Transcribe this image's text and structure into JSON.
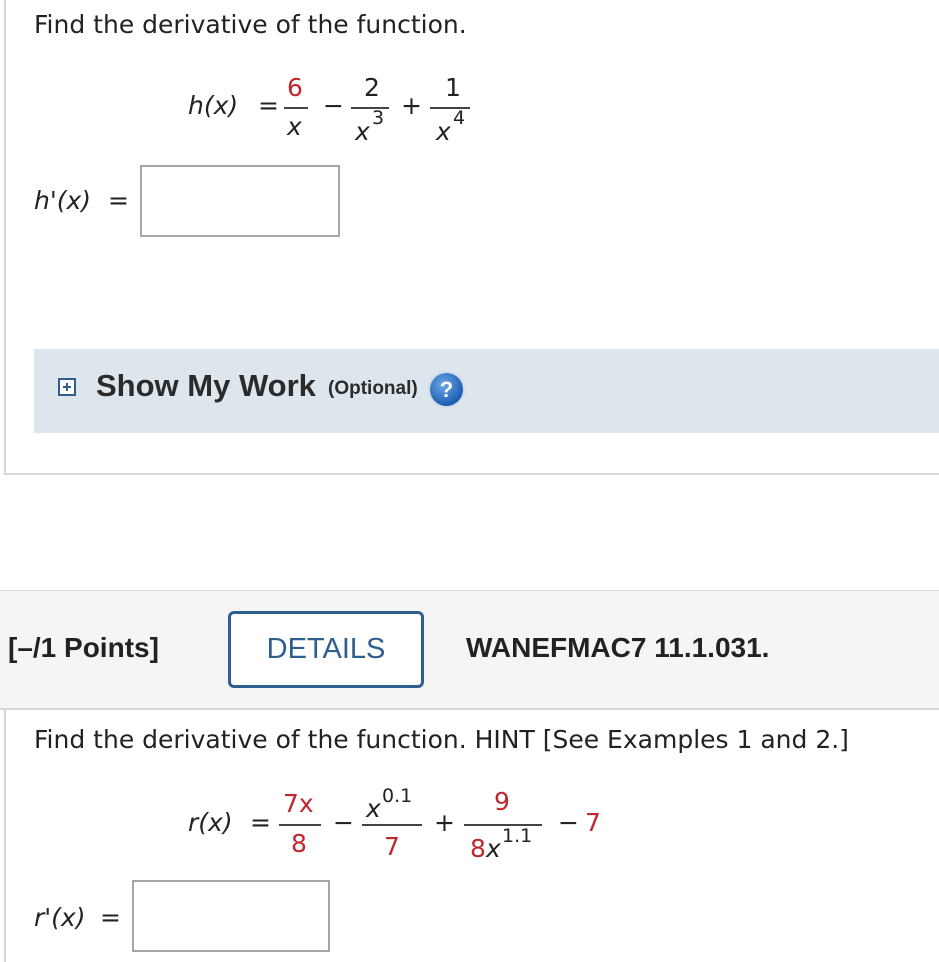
{
  "question1": {
    "prompt": "Find the derivative of the function.",
    "function": {
      "name": "h(x)",
      "equals": "=",
      "term1": {
        "num": "6",
        "den": "x"
      },
      "op1": "−",
      "term2": {
        "num": "2",
        "den_base": "x",
        "den_exp": "3"
      },
      "op2": "+",
      "term3": {
        "num": "1",
        "den_base": "x",
        "den_exp": "4"
      }
    },
    "answer_label": "h'(x)",
    "answer_equals": "=",
    "answer_value": "",
    "show_my_work": {
      "title": "Show My Work",
      "optional": "(Optional)",
      "expand_icon": "plus-square-icon",
      "help_icon": "help-question-icon",
      "help_glyph": "?"
    }
  },
  "question2": {
    "points": "[–/1 Points]",
    "details_button": "DETAILS",
    "code": "WANEFMAC7 11.1.031.",
    "prompt": "Find the derivative of the function. HINT [See Examples 1 and 2.]",
    "function": {
      "name": "r(x)",
      "equals": "=",
      "term1": {
        "num": "7x",
        "den": "8"
      },
      "op1": "−",
      "term2": {
        "num_base": "x",
        "num_exp": "0.1",
        "den": "7"
      },
      "op2": "+",
      "term3": {
        "num": "9",
        "den_coef": "8",
        "den_base": "x",
        "den_exp": "1.1"
      },
      "op3": "−",
      "constant": "7"
    },
    "answer_label": "r'(x)",
    "answer_equals": "=",
    "answer_value": ""
  },
  "colors": {
    "accent_red": "#c0262c",
    "button_blue": "#2f5f8f",
    "panel_bg": "#dde5ed"
  }
}
